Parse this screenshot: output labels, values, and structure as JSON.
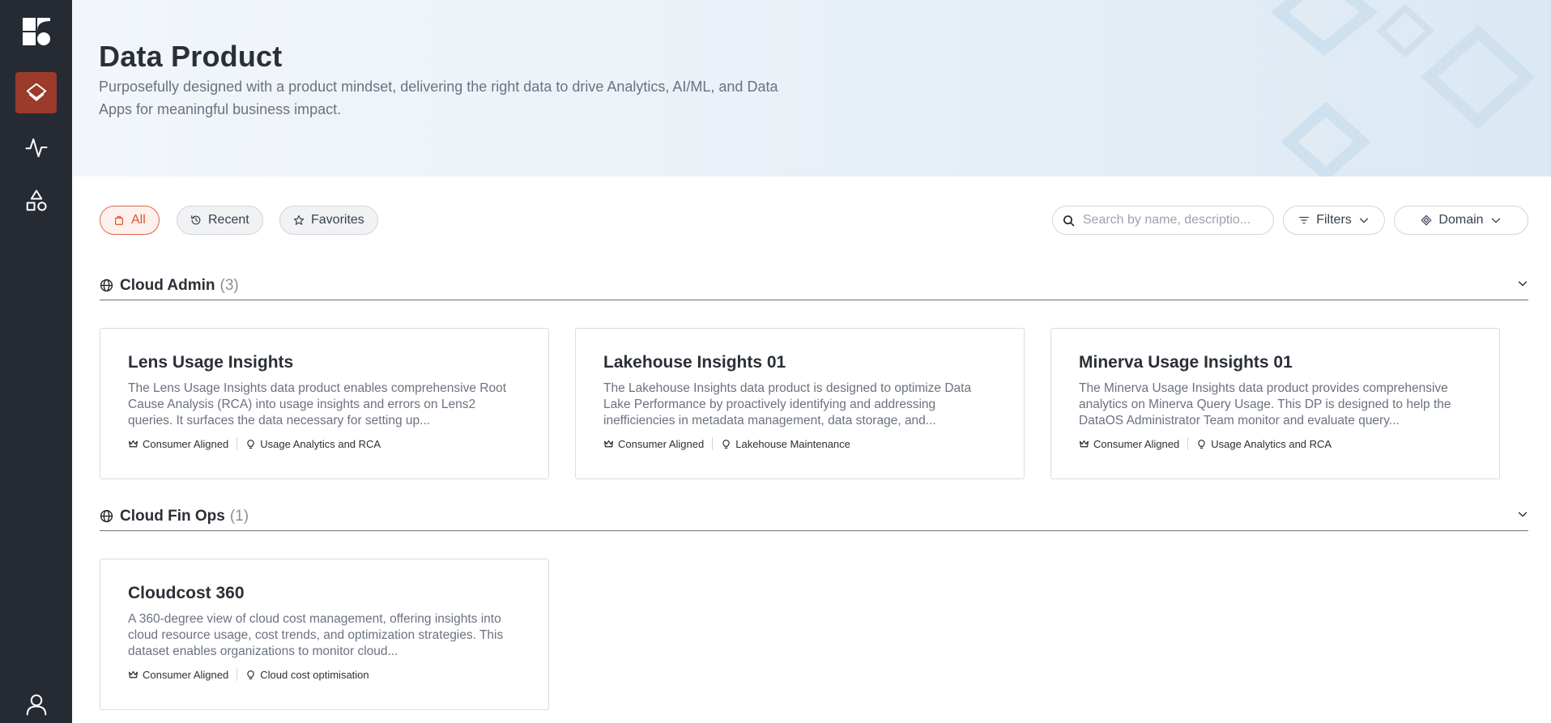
{
  "header": {
    "title": "Data Product",
    "subtitle": "Purposefully designed with a product mindset, delivering the right data to drive Analytics, AI/ML, and Data Apps for meaningful business impact."
  },
  "sidebar": {
    "items": [
      {
        "icon": "layers-icon",
        "active": true
      },
      {
        "icon": "activity-icon",
        "active": false
      },
      {
        "icon": "shapes-icon",
        "active": false
      }
    ],
    "bottom_icon": "user-icon"
  },
  "tabs": [
    {
      "label": "All",
      "icon": "bag-icon",
      "active": true
    },
    {
      "label": "Recent",
      "icon": "history-icon",
      "active": false
    },
    {
      "label": "Favorites",
      "icon": "star-icon",
      "active": false
    }
  ],
  "search": {
    "placeholder": "Search by name, descriptio..."
  },
  "filters_label": "Filters",
  "domain_label": "Domain",
  "sections": [
    {
      "name": "Cloud Admin",
      "count": "(3)",
      "cards": [
        {
          "title": "Lens Usage Insights",
          "desc": "The Lens Usage Insights data product enables comprehensive Root Cause Analysis (RCA) into usage insights and errors on Lens2 queries. It surfaces the data necessary for setting up...",
          "tag1": "Consumer Aligned",
          "tag2": "Usage Analytics and RCA"
        },
        {
          "title": "Lakehouse Insights 01",
          "desc": "The Lakehouse Insights data product is designed to optimize Data Lake Performance by proactively identifying and addressing inefficiencies in metadata management, data storage, and...",
          "tag1": "Consumer Aligned",
          "tag2": "Lakehouse Maintenance"
        },
        {
          "title": "Minerva Usage Insights 01",
          "desc": "The Minerva Usage Insights data product provides comprehensive analytics on Minerva Query Usage. This DP is designed to help the DataOS Administrator Team monitor and evaluate query...",
          "tag1": "Consumer Aligned",
          "tag2": "Usage Analytics and RCA"
        }
      ]
    },
    {
      "name": "Cloud Fin Ops",
      "count": "(1)",
      "cards": [
        {
          "title": "Cloudcost 360",
          "desc": "A 360-degree view of cloud cost management, offering insights into cloud resource usage, cost trends, and optimization strategies. This dataset enables organizations to monitor cloud...",
          "tag1": "Consumer Aligned",
          "tag2": "Cloud cost optimisation"
        }
      ]
    }
  ],
  "colors": {
    "sidebar_bg": "#262b33",
    "accent": "#9a3b2c",
    "tab_active": "#d9542f"
  }
}
